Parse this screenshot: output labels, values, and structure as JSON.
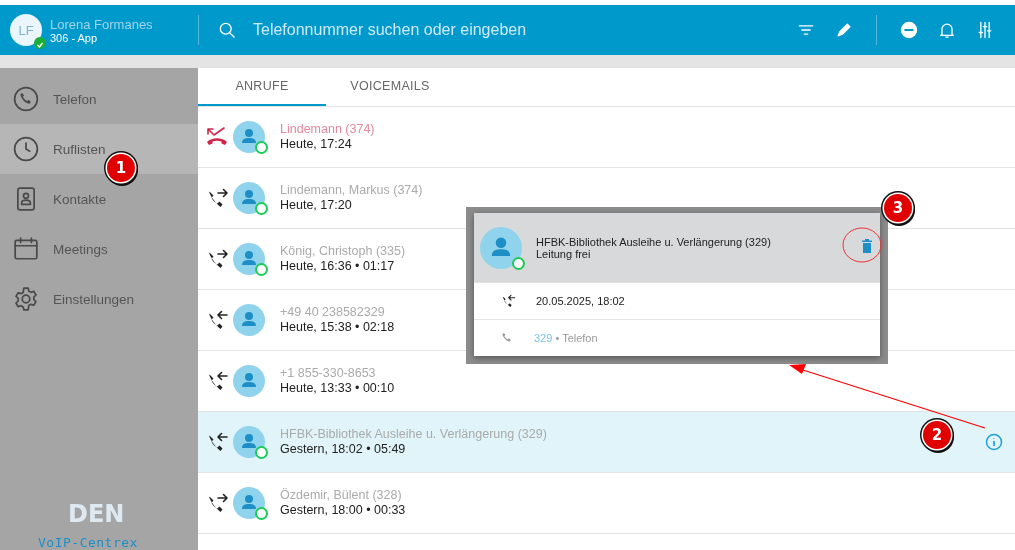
{
  "header": {
    "user": {
      "initials": "LF",
      "name": "Lorena Formanes",
      "line": "306 - App",
      "online": true
    },
    "search": {
      "placeholder": "Telefonnummer suchen oder eingeben"
    }
  },
  "sidebar": {
    "items": [
      {
        "label": "Telefon",
        "selected": false
      },
      {
        "label": "Ruflisten",
        "selected": true
      },
      {
        "label": "Kontakte",
        "selected": false
      },
      {
        "label": "Meetings",
        "selected": false
      },
      {
        "label": "Einstellungen",
        "selected": false
      }
    ],
    "logo": {
      "mark": "DEN",
      "caption": "VoIP-Centrex"
    }
  },
  "tabs": [
    {
      "label": "ANRUFE",
      "selected": true
    },
    {
      "label": "VOICEMAILS",
      "selected": false
    }
  ],
  "calls": [
    {
      "kind": "missed",
      "name": "Lindemann (374)",
      "detail": "Heute, 17:24",
      "online": true,
      "selected": false
    },
    {
      "kind": "outgoing",
      "name": "Lindemann, Markus (374)",
      "detail": "Heute, 17:20",
      "online": true,
      "selected": false
    },
    {
      "kind": "outgoing",
      "name": "König, Christoph (335)",
      "detail": "Heute, 16:36 • 01:17",
      "online": true,
      "selected": false
    },
    {
      "kind": "incoming",
      "name": "+49 40 238582329",
      "detail": "Heute, 15:38 • 02:18",
      "online": false,
      "selected": false
    },
    {
      "kind": "incoming",
      "name": "+1 855-330-8653",
      "detail": "Heute, 13:33 • 00:10",
      "online": false,
      "selected": false
    },
    {
      "kind": "incoming",
      "name": "HFBK-Bibliothek Ausleihe u. Verlängerung (329)",
      "detail": "Gestern, 18:02 • 05:49",
      "online": true,
      "selected": true
    },
    {
      "kind": "outgoing",
      "name": "Özdemir, Bülent (328)",
      "detail": "Gestern, 18:00 • 00:33",
      "online": true,
      "selected": false
    }
  ],
  "popup": {
    "name": "HFBK-Bibliothek Ausleihe u. Verlängerung (329)",
    "status": "Leitung frei",
    "online": true,
    "date": "20.05.2025, 18:02",
    "number": "329",
    "number_label": "• Telefon"
  },
  "annotations": [
    {
      "label": "1"
    },
    {
      "label": "2"
    },
    {
      "label": "3"
    }
  ]
}
